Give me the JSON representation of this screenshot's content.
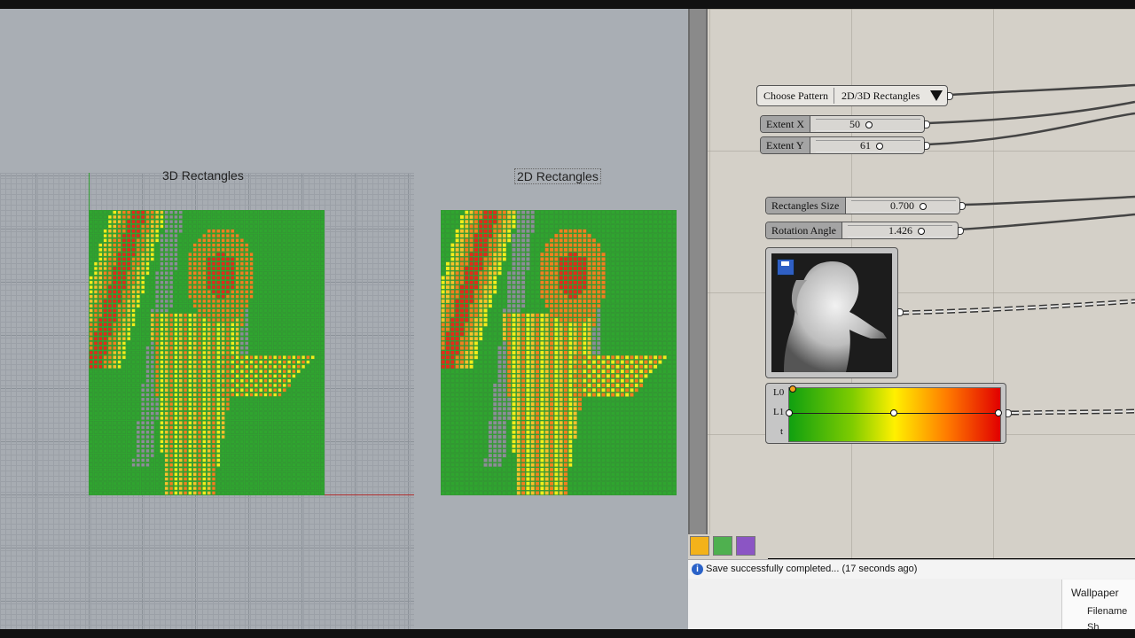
{
  "viewport": {
    "label_3d": "3D Rectangles",
    "label_2d": "2D Rectangles"
  },
  "grasshopper": {
    "value_list": {
      "label": "Choose Pattern",
      "selected": "2D/3D Rectangles"
    },
    "sliders": [
      {
        "name": "Extent X",
        "value": "50"
      },
      {
        "name": "Extent Y",
        "value": "61"
      },
      {
        "name": "Rectangles Size",
        "value": "0.700"
      },
      {
        "name": "Rotation Angle",
        "value": "1.426"
      }
    ],
    "gradient": {
      "inputs": [
        "L0",
        "L1",
        "t"
      ],
      "colors": [
        "#10a010",
        "#fff000",
        "#e10000"
      ]
    }
  },
  "status": {
    "message": "Save successfully completed... (17 seconds ago)"
  },
  "properties_panel": {
    "title": "Wallpaper",
    "field": "Filename",
    "partial": "Sh"
  }
}
